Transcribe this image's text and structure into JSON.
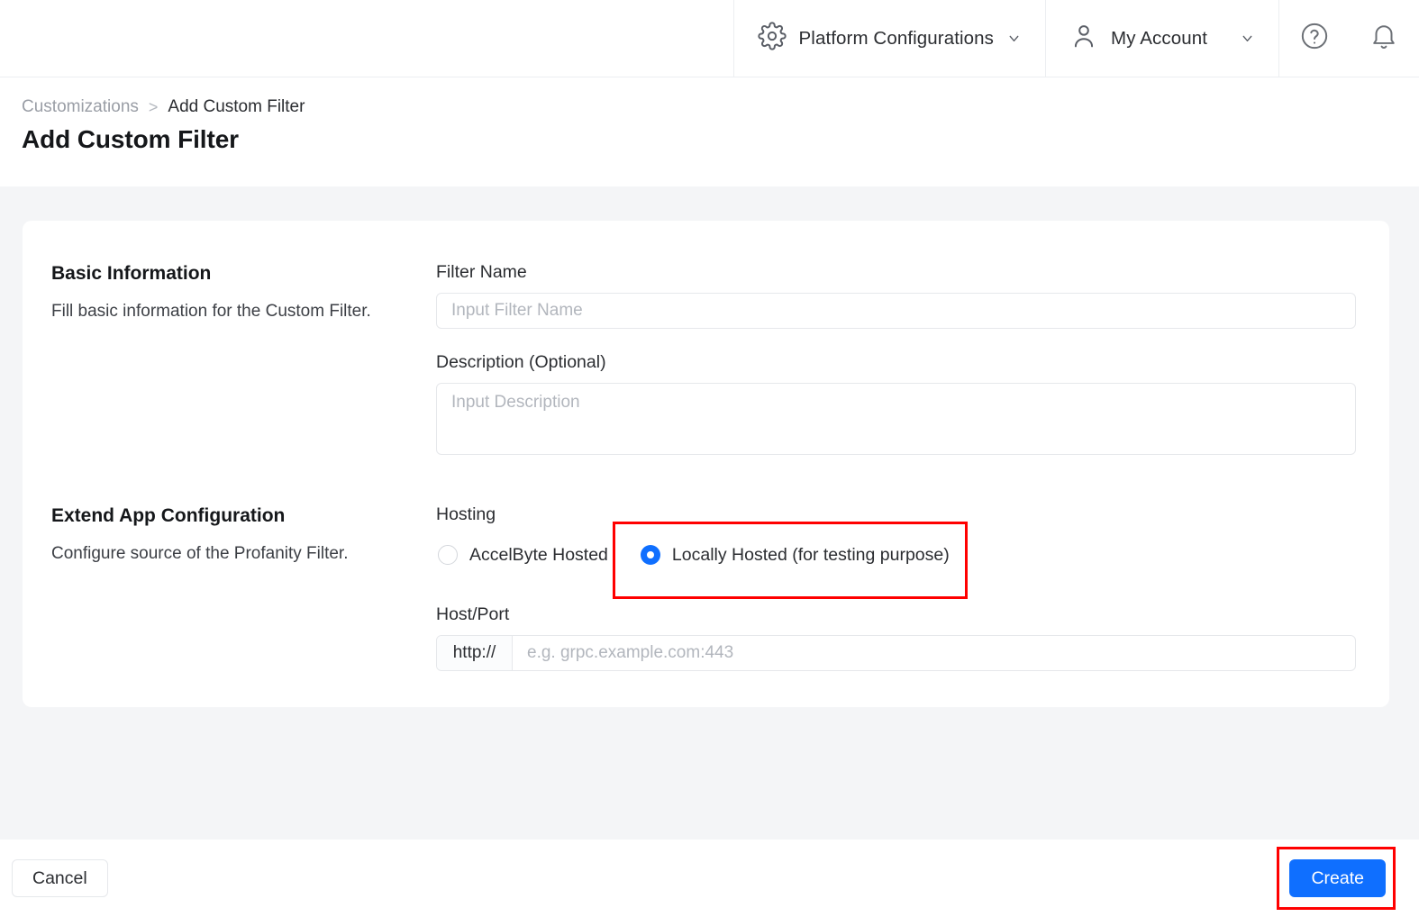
{
  "topnav": {
    "platform_configurations": {
      "label": "Platform Configurations",
      "icon": "gear-icon",
      "chevron": "chevron-down-icon"
    },
    "my_account": {
      "label": "My Account",
      "icon": "user-icon",
      "chevron": "chevron-down-icon"
    },
    "help": {
      "icon": "help-circle-icon"
    },
    "notifications": {
      "icon": "bell-icon"
    }
  },
  "header": {
    "breadcrumb": {
      "parent": "Customizations",
      "separator": ">",
      "current": "Add Custom Filter"
    },
    "title": "Add Custom Filter"
  },
  "form": {
    "basic_information": {
      "heading": "Basic Information",
      "description": "Fill basic information for the Custom Filter.",
      "filter_name": {
        "label": "Filter Name",
        "value": "",
        "placeholder": "Input Filter Name"
      },
      "description_field": {
        "label": "Description (Optional)",
        "value": "",
        "placeholder": "Input Description"
      }
    },
    "extend_app_configuration": {
      "heading": "Extend App Configuration",
      "description": "Configure source of the Profanity Filter.",
      "hosting": {
        "label": "Hosting",
        "options": [
          {
            "label": "AccelByte Hosted",
            "selected": false
          },
          {
            "label": "Locally Hosted (for testing purpose)",
            "selected": true
          }
        ],
        "selected_value": "Locally Hosted (for testing purpose)"
      },
      "host_port": {
        "label": "Host/Port",
        "prefix": "http://",
        "value": "",
        "placeholder": "e.g. grpc.example.com:443"
      }
    }
  },
  "footer": {
    "cancel_label": "Cancel",
    "create_label": "Create"
  },
  "colors": {
    "accent_blue": "#0f6fff",
    "annotation_red": "#ff0000",
    "page_background": "#f4f5f7",
    "card_background": "#ffffff",
    "border": "#e6e8eb",
    "text_primary": "#2b2d31",
    "text_muted": "#9a9ea6",
    "placeholder": "#b2b6bd"
  }
}
